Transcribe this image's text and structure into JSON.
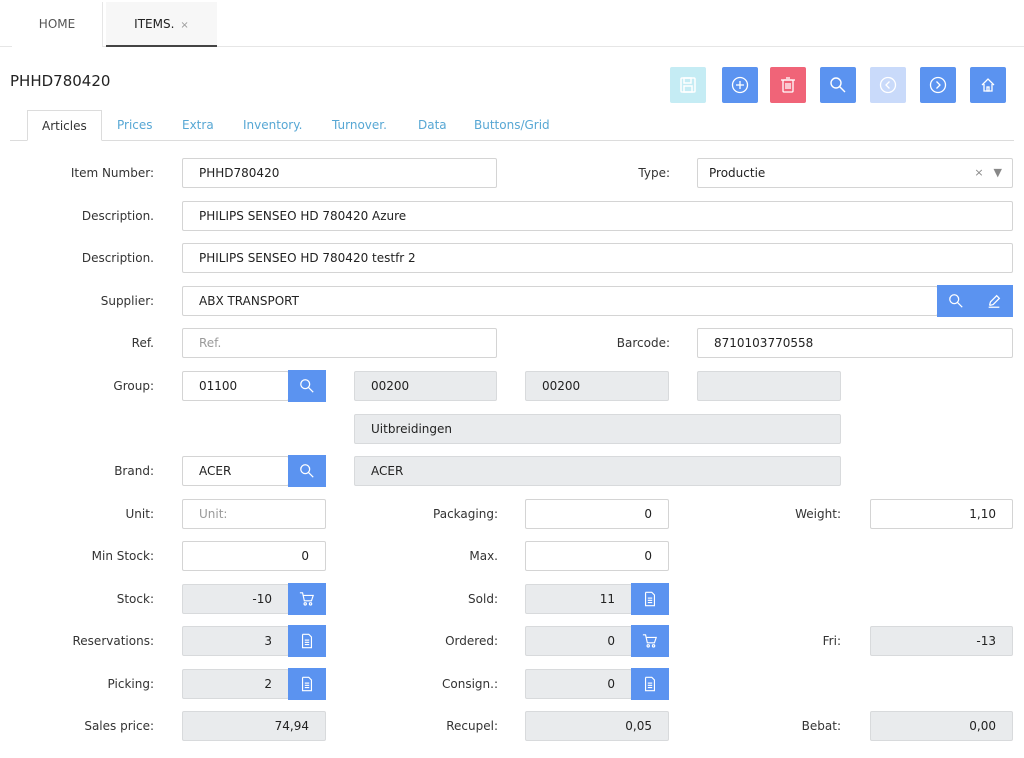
{
  "top_tabs": {
    "home": "HOME",
    "items": "ITEMS.",
    "close": "×"
  },
  "title": "PHHD780420",
  "toolbar_icons": [
    "save-icon",
    "plus-circle-icon",
    "trash-icon",
    "search-icon",
    "chevron-left-circle-icon",
    "chevron-right-circle-icon",
    "home-icon"
  ],
  "colors": {
    "primary": "#5b93f0",
    "danger": "#f06478",
    "save_disabled": "#c5ecf4",
    "disabled": "#c9dafa",
    "tab_link": "#57a7d4"
  },
  "tabs": [
    "Articles",
    "Prices",
    "Extra",
    "Inventory.",
    "Turnover.",
    "Data",
    "Buttons/Grid"
  ],
  "form": {
    "item_number": {
      "label": "Item Number:",
      "value": "PHHD780420"
    },
    "type": {
      "label": "Type:",
      "value": "Productie",
      "clear": "×",
      "caret": "▼"
    },
    "description1": {
      "label": "Description.",
      "value": "PHILIPS SENSEO HD 780420  Azure"
    },
    "description2": {
      "label": "Description.",
      "value": "PHILIPS SENSEO HD 780420 testfr 2"
    },
    "supplier": {
      "label": "Supplier:",
      "value": "ABX TRANSPORT"
    },
    "ref": {
      "label": "Ref.",
      "placeholder": "Ref."
    },
    "barcode": {
      "label": "Barcode:",
      "value": "8710103770558"
    },
    "group": {
      "label": "Group:",
      "value": "01100",
      "sub1": "00200",
      "sub2": "00200",
      "sub3": "",
      "description": "Uitbreidingen"
    },
    "brand": {
      "label": "Brand:",
      "value": "ACER",
      "description": "ACER"
    },
    "unit": {
      "label": "Unit:",
      "placeholder": "Unit:"
    },
    "packaging": {
      "label": "Packaging:",
      "value": "0"
    },
    "weight": {
      "label": "Weight:",
      "value": "1,10"
    },
    "min_stock": {
      "label": "Min Stock:",
      "value": "0"
    },
    "max": {
      "label": "Max.",
      "value": "0"
    },
    "stock": {
      "label": "Stock:",
      "value": "-10"
    },
    "sold": {
      "label": "Sold:",
      "value": "11"
    },
    "reservations": {
      "label": "Reservations:",
      "value": "3"
    },
    "ordered": {
      "label": "Ordered:",
      "value": "0"
    },
    "fri": {
      "label": "Fri:",
      "value": "-13"
    },
    "picking": {
      "label": "Picking:",
      "value": "2"
    },
    "consign": {
      "label": "Consign.:",
      "value": "0"
    },
    "sales_price": {
      "label": "Sales price:",
      "value": "74,94"
    },
    "recupel": {
      "label": "Recupel:",
      "value": "0,05"
    },
    "bebat": {
      "label": "Bebat:",
      "value": "0,00"
    }
  }
}
